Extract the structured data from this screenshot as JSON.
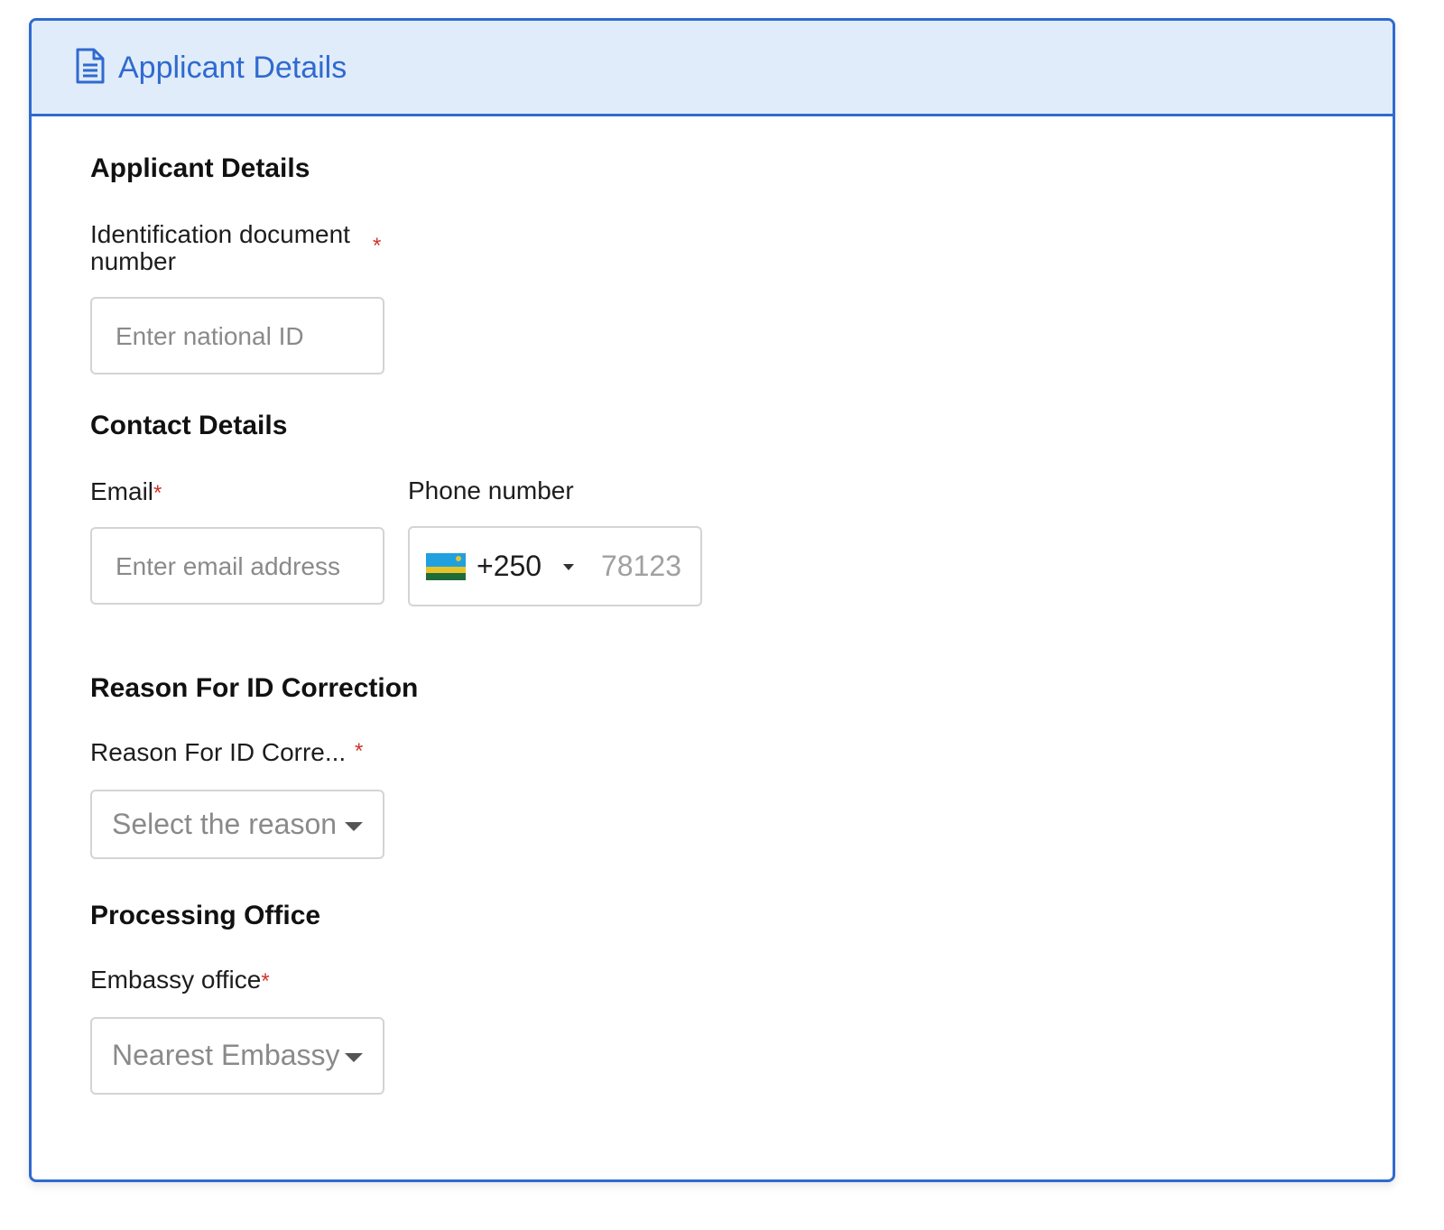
{
  "panel": {
    "title": "Applicant Details",
    "icon": "document-icon",
    "accent_color": "#2f6ad0",
    "header_bg": "#e0ecf9"
  },
  "applicant_section": {
    "title": "Applicant Details",
    "id_label_line1": "Identification document",
    "id_label_line2": "number",
    "id_placeholder": "Enter national ID",
    "required_mark": "*"
  },
  "contact_section": {
    "title": "Contact Details",
    "email_label": "Email",
    "email_placeholder": "Enter email address",
    "phone_label": "Phone number",
    "country_code": "+250",
    "country_flag": "rwanda-flag-icon",
    "phone_placeholder": "78123"
  },
  "reason_section": {
    "title": "Reason For ID Correction",
    "reason_label": "Reason For ID Corre...",
    "reason_placeholder": "Select the reason"
  },
  "office_section": {
    "title": "Processing Office",
    "embassy_label": "Embassy office",
    "embassy_placeholder": "Nearest Embassy"
  },
  "required_color": "#d0342c"
}
